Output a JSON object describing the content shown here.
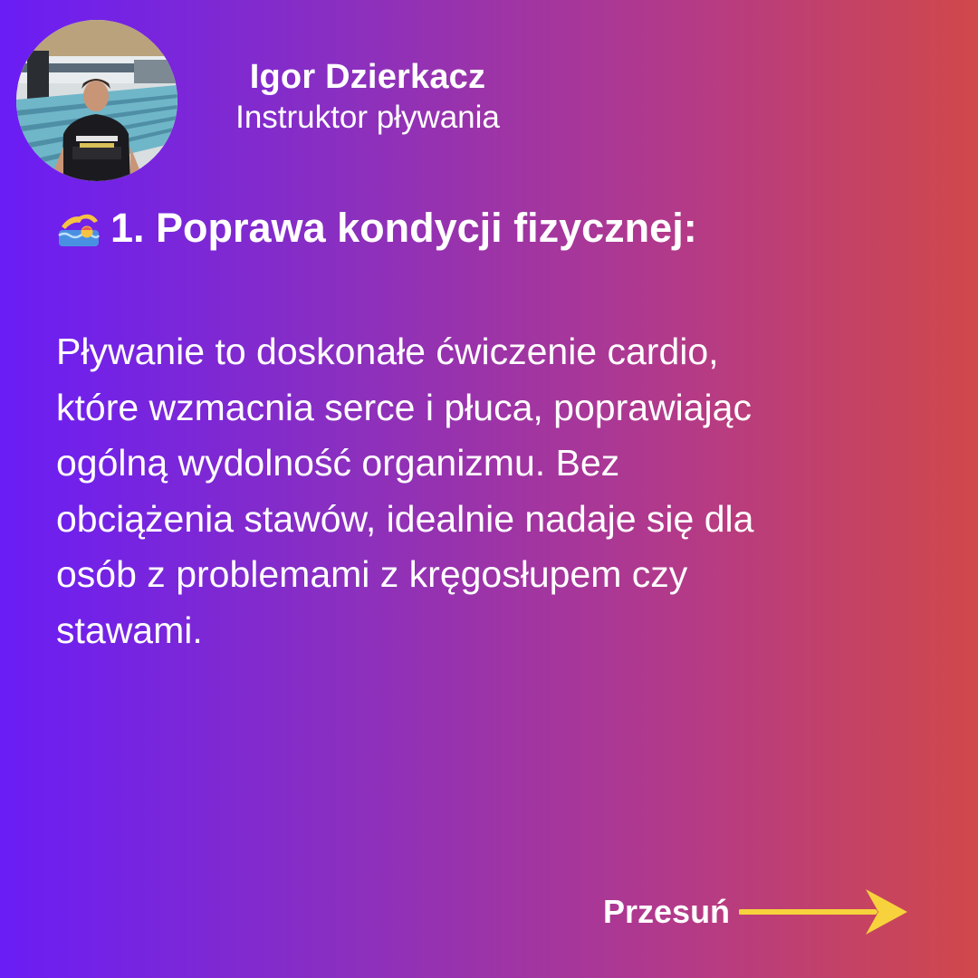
{
  "author": {
    "name": "Igor Dzierkacz",
    "role": "Instruktor pływania"
  },
  "heading": {
    "icon": "swimmer-emoji-icon",
    "text": "1. Poprawa kondycji fizycznej:"
  },
  "body_lines": [
    "Pływanie to doskonałe ćwiczenie cardio,",
    "które wzmacnia serce i płuca, poprawiając",
    "ogólną wydolność organizmu. Bez",
    "obciążenia stawów, idealnie nadaje się dla",
    "osób z problemami z kręgosłupem czy",
    "stawami."
  ],
  "swipe": {
    "label": "Przesuń",
    "icon": "arrow-right-icon",
    "color": "#f7d23c"
  },
  "colors": {
    "gradient_start": "#6a1df5",
    "gradient_end": "#d0484a",
    "text": "#ffffff"
  }
}
